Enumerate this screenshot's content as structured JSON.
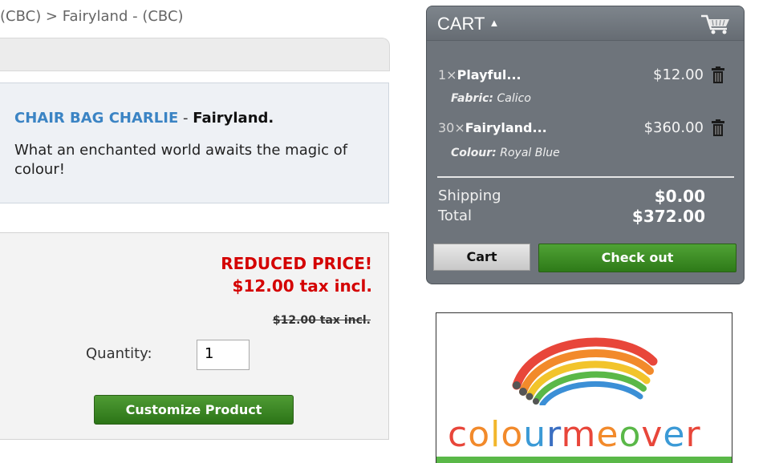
{
  "breadcrumb": "(CBC) > Fairyland - (CBC)",
  "product": {
    "name": "CHAIR BAG CHARLIE",
    "separator": " - ",
    "category": "Fairyland.",
    "description": "What an enchanted world awaits the magic of colour!"
  },
  "pricing": {
    "reduced_label": "REDUCED PRICE!",
    "price": "$12.00 tax incl.",
    "old_price": "$12.00 tax incl.",
    "quantity_label": "Quantity:",
    "quantity_value": "1",
    "customize_label": "Customize Product"
  },
  "cart": {
    "title": "CART",
    "caret": "▲",
    "items": [
      {
        "qty": "1×",
        "name": "Playful...",
        "price": "$12.00",
        "attr_name": "Fabric:",
        "attr_value": "Calico"
      },
      {
        "qty": "30×",
        "name": "Fairyland...",
        "price": "$360.00",
        "attr_name": "Colour:",
        "attr_value": "Royal Blue"
      }
    ],
    "shipping_label": "Shipping",
    "shipping_value": "$0.00",
    "total_label": "Total",
    "total_value": "$372.00",
    "cart_button": "Cart",
    "checkout_button": "Check out"
  },
  "ad": {
    "letters": [
      {
        "ch": "c",
        "color": "#e8463a"
      },
      {
        "ch": "o",
        "color": "#f28a2b"
      },
      {
        "ch": "l",
        "color": "#f2b62b"
      },
      {
        "ch": "o",
        "color": "#f28a2b"
      },
      {
        "ch": "u",
        "color": "#3b9ad6"
      },
      {
        "ch": "r",
        "color": "#3b6fc2"
      },
      {
        "ch": "m",
        "color": "#e8463a"
      },
      {
        "ch": "e",
        "color": "#f28a2b"
      },
      {
        "ch": "o",
        "color": "#5ab848"
      },
      {
        "ch": "v",
        "color": "#e8463a"
      },
      {
        "ch": "e",
        "color": "#3b9ad6"
      },
      {
        "ch": "r",
        "color": "#e8463a"
      }
    ]
  }
}
